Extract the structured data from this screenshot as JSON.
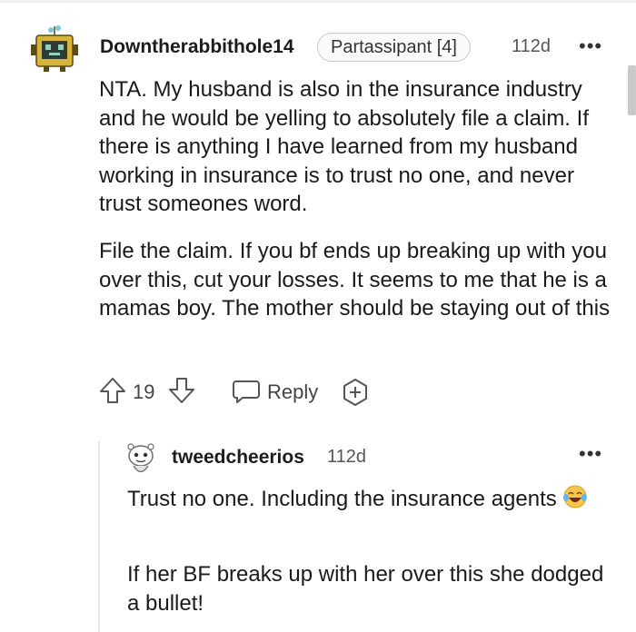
{
  "comment": {
    "username": "Downtherabbithole14",
    "flair": "Partassipant [4]",
    "age": "112d",
    "more": "•••",
    "paragraphs": [
      "NTA. My husband is also in the insurance industry and he would be yelling to absolutely file a claim. If there is anything I have learned from my husband working in insurance is to trust no one, and never trust someones word.",
      "File the claim. If you bf ends up breaking up with you over this, cut your losses. It seems to me that he is a mamas boy. The mother should be staying out of this"
    ],
    "votes": "19",
    "reply_label": "Reply"
  },
  "reply": {
    "username": "tweedcheerios",
    "age": "112d",
    "more": "•••",
    "paragraph1": "Trust no one. Including the insurance agents",
    "paragraph2": "If her BF breaks up with her over this she dodged a bullet!"
  },
  "icons": {
    "upvote": "upvote-arrow-icon",
    "downvote": "downvote-arrow-icon",
    "reply": "speech-bubble-icon",
    "award": "award-plus-icon",
    "emoji": "face-with-tears-of-joy-emoji"
  },
  "colors": {
    "text": "#1a1a1b",
    "muted": "#555555",
    "flair_border": "#c9c9c9",
    "thread_line": "#e6e6e6"
  }
}
